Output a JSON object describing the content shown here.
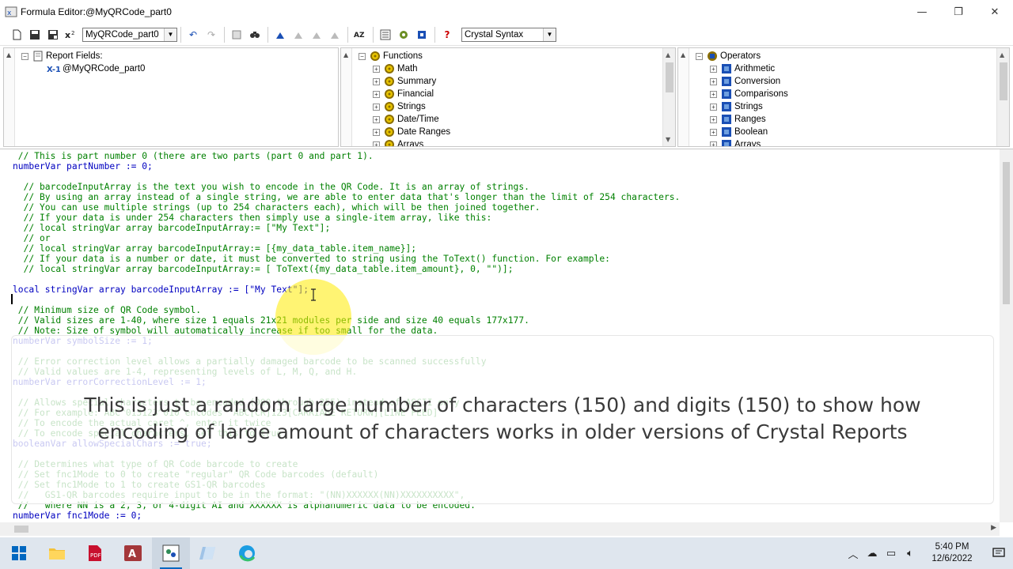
{
  "window": {
    "title": "Formula Editor:@MyQRCode_part0",
    "minimize": "—",
    "maximize": "❐",
    "close": "✕"
  },
  "toolbar": {
    "formula_combo": "MyQRCode_part0",
    "syntax_combo": "Crystal Syntax"
  },
  "report_fields": {
    "root": "Report Fields:",
    "items": [
      "@MyQRCode_part0"
    ]
  },
  "functions": {
    "root": "Functions",
    "items": [
      "Math",
      "Summary",
      "Financial",
      "Strings",
      "Date/Time",
      "Date Ranges",
      "Arrays"
    ]
  },
  "operators": {
    "root": "Operators",
    "items": [
      "Arithmetic",
      "Conversion",
      "Comparisons",
      "Strings",
      "Ranges",
      "Boolean",
      "Arrays"
    ]
  },
  "code_lines": [
    {
      "k": "cmt",
      "t": " // This is part number 0 (there are two parts (part 0 and part 1)."
    },
    {
      "k": "kw",
      "t": "numberVar partNumber := 0;"
    },
    {
      "k": "tx",
      "t": ""
    },
    {
      "k": "cmt",
      "t": "  // barcodeInputArray is the text you wish to encode in the QR Code. It is an array of strings."
    },
    {
      "k": "cmt",
      "t": "  // By using an array instead of a single string, we are able to enter data that's longer than the limit of 254 characters."
    },
    {
      "k": "cmt",
      "t": "  // You can use multiple strings (up to 254 characters each), which will be then joined together."
    },
    {
      "k": "cmt",
      "t": "  // If your data is under 254 characters then simply use a single-item array, like this:"
    },
    {
      "k": "cmt",
      "t": "  // local stringVar array barcodeInputArray:= [\"My Text\"];"
    },
    {
      "k": "cmt",
      "t": "  // or"
    },
    {
      "k": "cmt",
      "t": "  // local stringVar array barcodeInputArray:= [{my_data_table.item_name}];"
    },
    {
      "k": "cmt",
      "t": "  // If your data is a number or date, it must be converted to string using the ToText() function. For example:"
    },
    {
      "k": "cmt",
      "t": "  // local stringVar array barcodeInputArray:= [ ToText({my_data_table.item_amount}, 0, \"\")];"
    },
    {
      "k": "tx",
      "t": ""
    },
    {
      "k": "kw",
      "t": "local stringVar array barcodeInputArray := [\"My Text\"];"
    },
    {
      "k": "tx",
      "t": ""
    },
    {
      "k": "cmt",
      "t": " // Minimum size of QR Code symbol."
    },
    {
      "k": "cmt",
      "t": " // Valid sizes are 1-40, where size 1 equals 21x21 modules per side and size 40 equals 177x177."
    },
    {
      "k": "cmt",
      "t": " // Note: Size of symbol will automatically increase if too small for the data."
    },
    {
      "k": "kw",
      "t": "numberVar symbolSize := 1;"
    },
    {
      "k": "tx",
      "t": ""
    },
    {
      "k": "cmt",
      "t": " // Error correction level allows a partially damaged barcode to be scanned successfully"
    },
    {
      "k": "cmt",
      "t": " // Valid values are 1-4, representing levels of L, M, Q, and H."
    },
    {
      "k": "kw",
      "t": "numberVar errorCorrectionLevel := 1;"
    },
    {
      "k": "tx",
      "t": ""
    },
    {
      "k": "cmt",
      "t": " // Allows special characters to be encoded (000 through 255) instead of ASCII only"
    },
    {
      "k": "cmt",
      "t": " // For example: ABC^013123^010 encodes \"ABC[CR]123[CARRIAGE RETURN][LINE FEED]\""
    },
    {
      "k": "cmt",
      "t": " // To encode the actual caret ^, enter it twice"
    },
    {
      "k": "cmt",
      "t": " // To encode special characters, set this to true"
    },
    {
      "k": "kw",
      "t": "booleanVar allowSpecialChars := true;"
    },
    {
      "k": "tx",
      "t": ""
    },
    {
      "k": "cmt",
      "t": " // Determines what type of QR Code barcode to create"
    },
    {
      "k": "cmt",
      "t": " // Set fnc1Mode to 0 to create \"regular\" QR Code barcodes (default)"
    },
    {
      "k": "cmt",
      "t": " // Set fnc1Mode to 1 to create GS1-QR barcodes"
    },
    {
      "k": "cmt",
      "t": " //   GS1-QR barcodes require input to be in the format: \"(NN)XXXXXX(NN)XXXXXXXXXX\","
    },
    {
      "k": "cmt",
      "t": " //   where NN is a 2, 3, or 4-digit AI and XXXXXX is alphanumeric data to be encoded."
    },
    {
      "k": "kw",
      "t": "numberVar fnc1Mode := 0;"
    }
  ],
  "caption": {
    "line1": "This is just a random large number of characters (150) and digits (150) to show how",
    "line2": "encoding of large amount of characters works in older versions of Crystal Reports"
  },
  "taskbar": {
    "time": "5:40 PM",
    "date": "12/6/2022"
  }
}
